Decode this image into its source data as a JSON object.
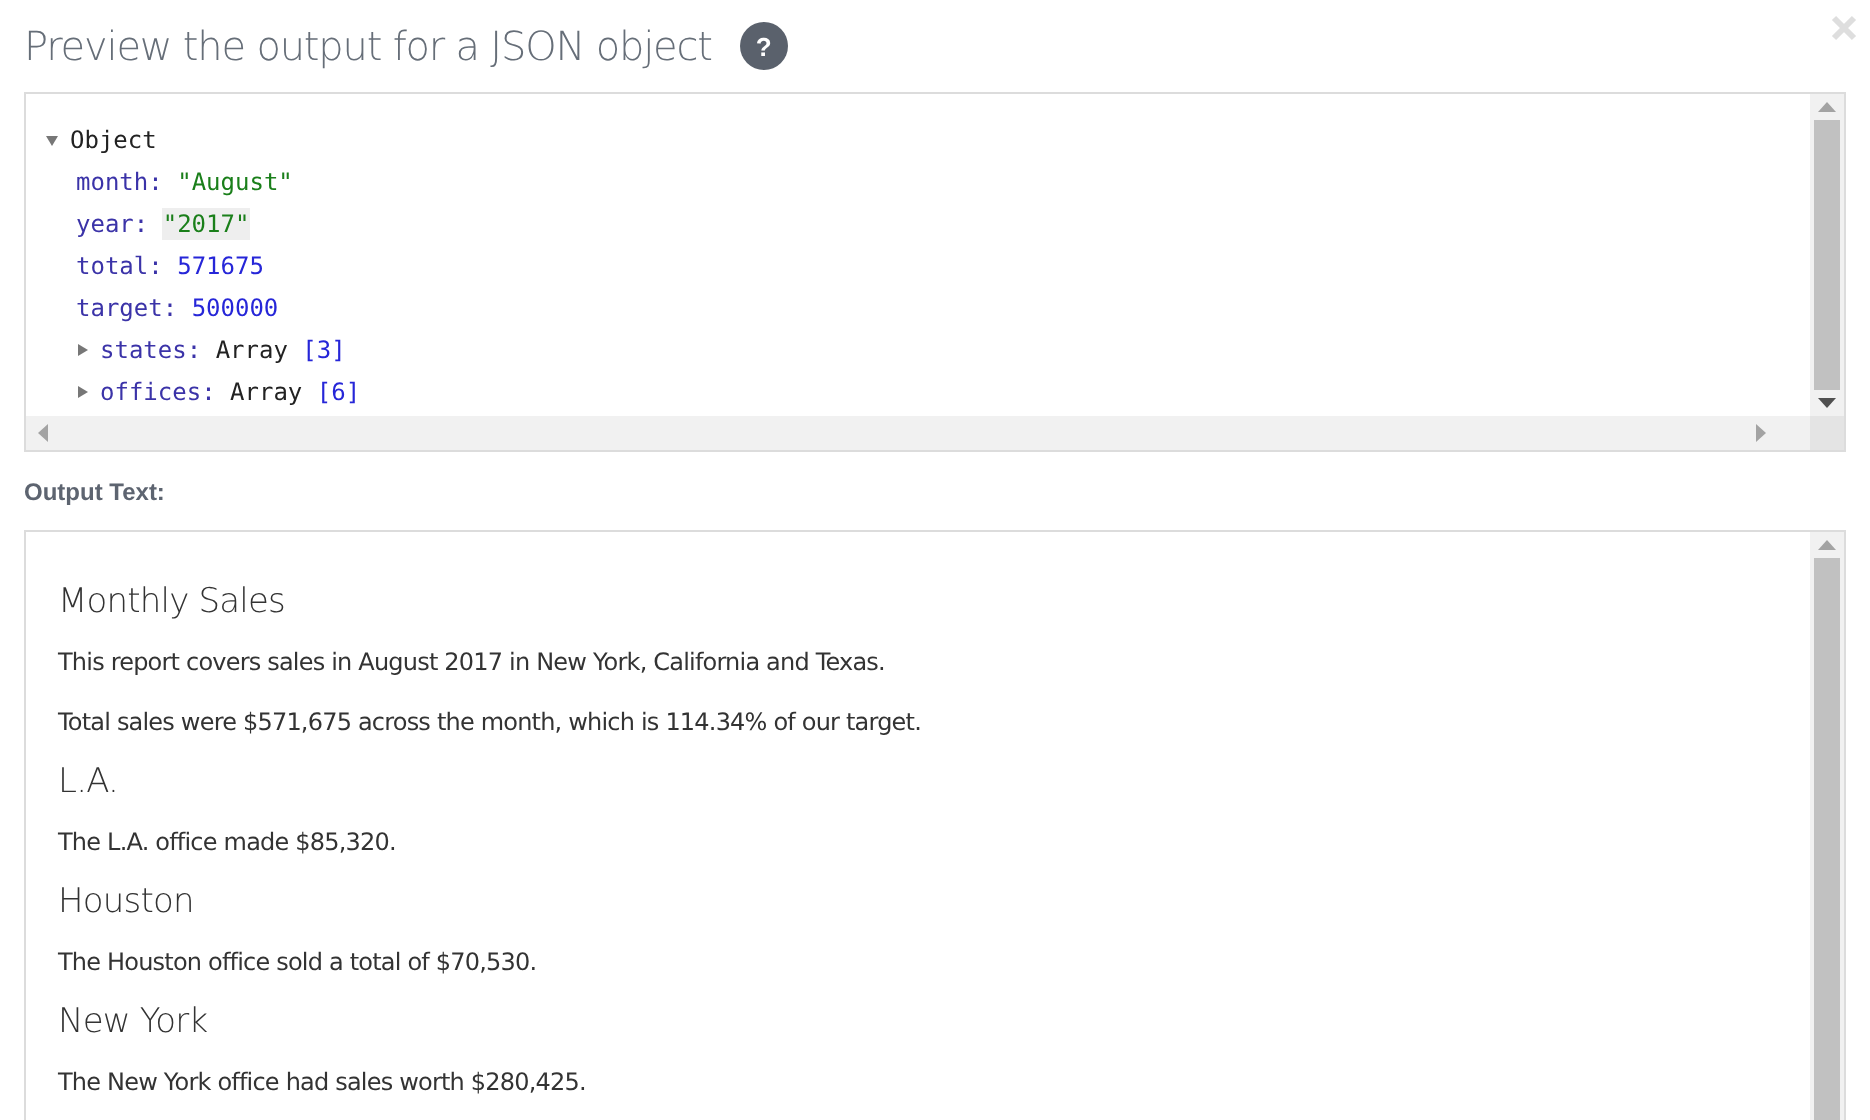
{
  "dialog": {
    "title": "Preview the output for a JSON object",
    "help": "?"
  },
  "json_view": {
    "root": {
      "label": "Object",
      "expanded": true,
      "children": [
        {
          "key": "month:",
          "value": "\"August\"",
          "kind": "string",
          "highlighted": false
        },
        {
          "key": "year:",
          "value": "\"2017\"",
          "kind": "string",
          "highlighted": true
        },
        {
          "key": "total:",
          "value": "571675",
          "kind": "number",
          "highlighted": false
        },
        {
          "key": "target:",
          "value": "500000",
          "kind": "number",
          "highlighted": false
        },
        {
          "key": "states:",
          "type_name": "Array",
          "count": "[3]",
          "kind": "array",
          "expanded": false
        },
        {
          "key": "offices:",
          "type_name": "Array",
          "count": "[6]",
          "kind": "array",
          "expanded": false
        }
      ]
    }
  },
  "output": {
    "label": "Output Text:",
    "blocks": [
      {
        "kind": "heading",
        "text": "Monthly Sales"
      },
      {
        "kind": "paragraph",
        "text": "This report covers sales in August 2017 in New York, California and Texas."
      },
      {
        "kind": "paragraph",
        "text": "Total sales were $571,675 across the month, which is 114.34% of our target."
      },
      {
        "kind": "heading",
        "text": "L.A."
      },
      {
        "kind": "paragraph",
        "text": "The L.A. office made $85,320."
      },
      {
        "kind": "heading",
        "text": "Houston"
      },
      {
        "kind": "paragraph",
        "text": "The Houston office sold a total of $70,530."
      },
      {
        "kind": "heading",
        "text": "New York"
      },
      {
        "kind": "paragraph",
        "text": "The New York office had sales worth $280,425."
      }
    ]
  }
}
